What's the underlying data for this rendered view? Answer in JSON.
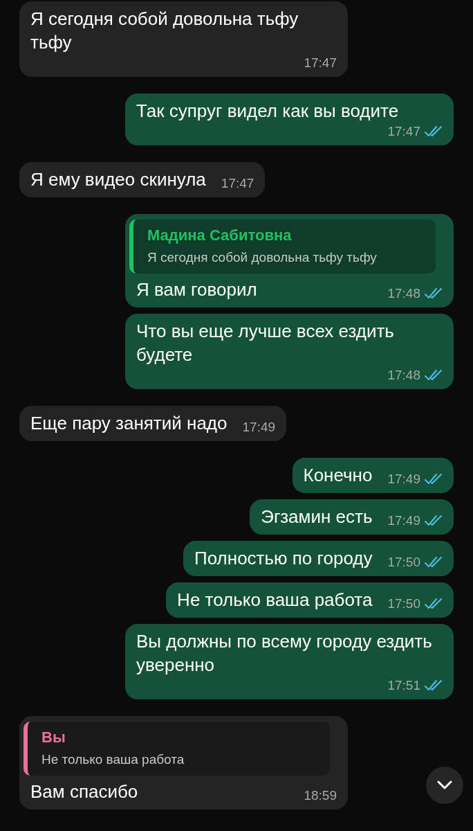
{
  "messages": [
    {
      "kind": "incoming",
      "text": "Я сегодня собой довольна тьфу тьфу",
      "time": "17:47"
    },
    {
      "kind": "outgoing",
      "text": "Так супруг видел как вы водите",
      "time": "17:47",
      "read": true
    },
    {
      "kind": "incoming",
      "text": "Я ему видео скинула",
      "time": "17:47"
    },
    {
      "kind": "outgoing",
      "quote": {
        "author": "Мадина Сабитовна",
        "text": "Я сегодня собой довольна тьфу тьфу",
        "color": "#21c063"
      },
      "text": "Я вам говорил",
      "time": "17:48",
      "read": true
    },
    {
      "kind": "outgoing",
      "text": "Что вы еще лучше всех ездить будете",
      "time": "17:48",
      "read": true
    },
    {
      "kind": "incoming",
      "text": "Еще пару занятий надо",
      "time": "17:49"
    },
    {
      "kind": "outgoing",
      "text": "Конечно",
      "time": "17:49",
      "read": true
    },
    {
      "kind": "outgoing",
      "text": "Эгзамин есть",
      "time": "17:49",
      "read": true
    },
    {
      "kind": "outgoing",
      "text": "Полностью по городу",
      "time": "17:50",
      "read": true
    },
    {
      "kind": "outgoing",
      "text": "Не только ваша работа",
      "time": "17:50",
      "read": true
    },
    {
      "kind": "outgoing",
      "text": "Вы должны по всему городу ездить уверенно",
      "time": "17:51",
      "read": true
    },
    {
      "kind": "incoming",
      "quote": {
        "author": "Вы",
        "text": "Не только ваша работа",
        "color": "#e8709b"
      },
      "text": "Вам спасибо",
      "time": "18:59"
    }
  ]
}
